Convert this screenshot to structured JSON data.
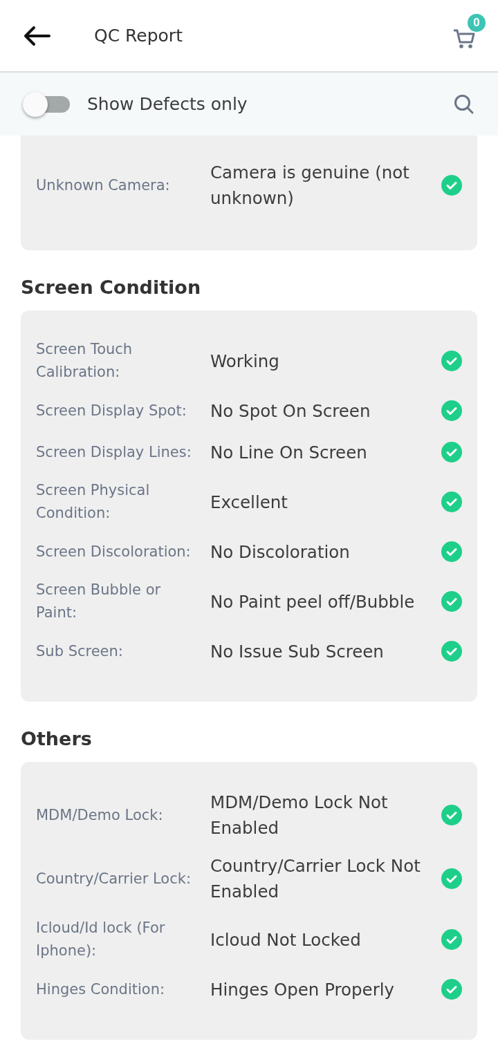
{
  "header": {
    "title": "QC Report",
    "cart_count": "0"
  },
  "filter": {
    "label": "Show Defects only",
    "on": false
  },
  "sections": [
    {
      "rows": [
        {
          "label": "Unknown Camera:",
          "value": "Camera is genuine (not unknown)",
          "ok": true
        }
      ]
    },
    {
      "title": "Screen Condition",
      "rows": [
        {
          "label": "Screen Touch Calibration:",
          "value": "Working",
          "ok": true
        },
        {
          "label": "Screen Display Spot:",
          "value": "No Spot On Screen",
          "ok": true
        },
        {
          "label": "Screen Display Lines:",
          "value": "No Line On Screen",
          "ok": true
        },
        {
          "label": "Screen Physical Condition:",
          "value": "Excellent",
          "ok": true
        },
        {
          "label": "Screen Discoloration:",
          "value": "No Discoloration",
          "ok": true
        },
        {
          "label": "Screen Bubble or Paint:",
          "value": "No Paint peel off/Bubble",
          "ok": true
        },
        {
          "label": "Sub Screen:",
          "value": "No Issue Sub Screen",
          "ok": true
        }
      ]
    },
    {
      "title": "Others",
      "rows": [
        {
          "label": "MDM/Demo Lock:",
          "value": "MDM/Demo Lock Not Enabled",
          "ok": true
        },
        {
          "label": "Country/Carrier Lock:",
          "value": "Country/Carrier Lock Not Enabled",
          "ok": true
        },
        {
          "label": "Icloud/Id lock (For Iphone):",
          "value": "Icloud Not Locked",
          "ok": true
        },
        {
          "label": "Hinges Condition:",
          "value": "Hinges Open Properly",
          "ok": true
        }
      ]
    }
  ]
}
